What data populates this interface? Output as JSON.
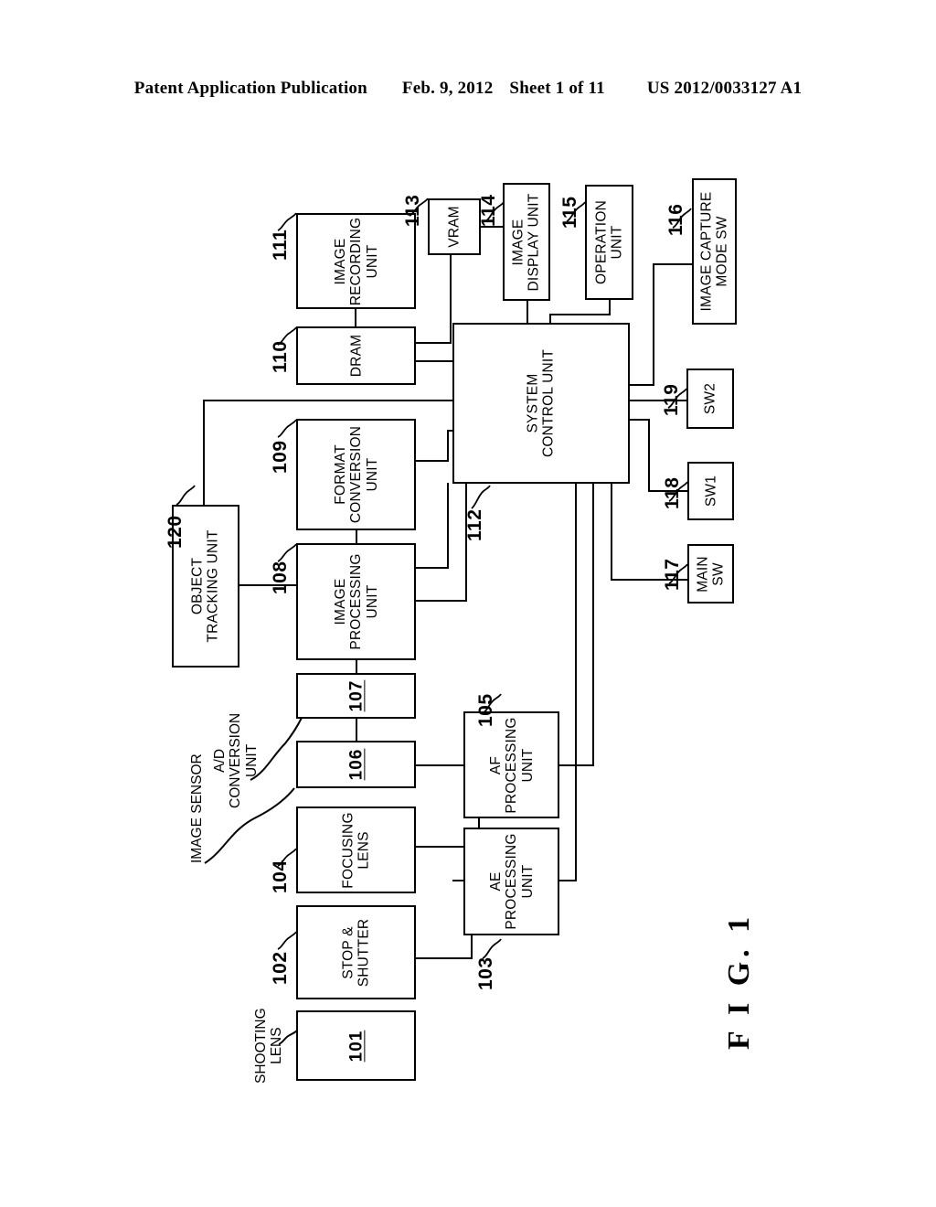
{
  "header": {
    "publication": "Patent Application Publication",
    "date": "Feb. 9, 2012",
    "sheet": "Sheet 1 of 11",
    "patent_number": "US 2012/0033127 A1"
  },
  "figure": {
    "caption": "F I G.  1"
  },
  "diagram": {
    "type": "block-diagram",
    "orientation": "rotated-90-ccw",
    "blocks": [
      {
        "ref": "101",
        "label": "",
        "inner_number": "101",
        "external_label": "SHOOTING LENS"
      },
      {
        "ref": "102",
        "label": "STOP &\nSHUTTER",
        "inner_number": "",
        "external_label": ""
      },
      {
        "ref": "103",
        "label": "AE\nPROCESSING\nUNIT",
        "inner_number": "",
        "external_label": ""
      },
      {
        "ref": "104",
        "label": "FOCUSING\nLENS",
        "inner_number": "",
        "external_label": ""
      },
      {
        "ref": "105",
        "label": "AF\nPROCESSING\nUNIT",
        "inner_number": "",
        "external_label": ""
      },
      {
        "ref": "106",
        "label": "",
        "inner_number": "106",
        "external_label": "IMAGE SENSOR"
      },
      {
        "ref": "107",
        "label": "",
        "inner_number": "107",
        "external_label": "A/D\nCONVERSION\nUNIT"
      },
      {
        "ref": "108",
        "label": "IMAGE\nPROCESSING\nUNIT",
        "inner_number": "",
        "external_label": ""
      },
      {
        "ref": "109",
        "label": "FORMAT\nCONVERSION\nUNIT",
        "inner_number": "",
        "external_label": ""
      },
      {
        "ref": "110",
        "label": "DRAM",
        "inner_number": "",
        "external_label": ""
      },
      {
        "ref": "111",
        "label": "IMAGE\nRECORDING\nUNIT",
        "inner_number": "",
        "external_label": ""
      },
      {
        "ref": "112",
        "label": "SYSTEM\nCONTROL UNIT",
        "inner_number": "",
        "external_label": ""
      },
      {
        "ref": "113",
        "label": "VRAM",
        "inner_number": "",
        "external_label": ""
      },
      {
        "ref": "114",
        "label": "IMAGE\nDISPLAY UNIT",
        "inner_number": "",
        "external_label": ""
      },
      {
        "ref": "115",
        "label": "OPERATION\nUNIT",
        "inner_number": "",
        "external_label": ""
      },
      {
        "ref": "116",
        "label": "IMAGE CAPTURE\nMODE SW",
        "inner_number": "",
        "external_label": ""
      },
      {
        "ref": "117",
        "label": "MAIN\nSW",
        "inner_number": "",
        "external_label": ""
      },
      {
        "ref": "118",
        "label": "SW1",
        "inner_number": "",
        "external_label": ""
      },
      {
        "ref": "119",
        "label": "SW2",
        "inner_number": "",
        "external_label": ""
      },
      {
        "ref": "120",
        "label": "OBJECT\nTRACKING UNIT",
        "inner_number": "",
        "external_label": ""
      }
    ]
  },
  "labels": {
    "image_recording_unit_l1": "IMAGE",
    "image_recording_unit_l2": "RECORDING",
    "image_recording_unit_l3": "UNIT",
    "dram": "DRAM",
    "vram": "VRAM",
    "image_display_unit_l1": "IMAGE",
    "image_display_unit_l2": "DISPLAY UNIT",
    "operation_unit_l1": "OPERATION",
    "operation_unit_l2": "UNIT",
    "image_capture_mode_sw_l1": "IMAGE CAPTURE",
    "image_capture_mode_sw_l2": "MODE SW",
    "system_control_unit_l1": "SYSTEM",
    "system_control_unit_l2": "CONTROL UNIT",
    "sw2": "SW2",
    "sw1": "SW1",
    "main_sw_l1": "MAIN",
    "main_sw_l2": "SW",
    "format_conversion_unit_l1": "FORMAT",
    "format_conversion_unit_l2": "CONVERSION",
    "format_conversion_unit_l3": "UNIT",
    "object_tracking_unit_l1": "OBJECT",
    "object_tracking_unit_l2": "TRACKING UNIT",
    "image_processing_unit_l1": "IMAGE",
    "image_processing_unit_l2": "PROCESSING",
    "image_processing_unit_l3": "UNIT",
    "ad_conversion_unit_l1": "A/D",
    "ad_conversion_unit_l2": "CONVERSION",
    "ad_conversion_unit_l3": "UNIT",
    "image_sensor": "IMAGE SENSOR",
    "focusing_lens_l1": "FOCUSING",
    "focusing_lens_l2": "LENS",
    "stop_shutter_l1": "STOP &",
    "stop_shutter_l2": "SHUTTER",
    "af_processing_unit_l1": "AF",
    "af_processing_unit_l2": "PROCESSING",
    "af_processing_unit_l3": "UNIT",
    "ae_processing_unit_l1": "AE",
    "ae_processing_unit_l2": "PROCESSING",
    "ae_processing_unit_l3": "UNIT",
    "shooting_lens_l1": "SHOOTING",
    "shooting_lens_l2": "LENS",
    "num_101": "101",
    "num_106": "106",
    "num_107": "107"
  },
  "refs": {
    "r101": "101",
    "r102": "102",
    "r103": "103",
    "r104": "104",
    "r105": "105",
    "r108": "108",
    "r109": "109",
    "r110": "110",
    "r111": "111",
    "r112": "112",
    "r113": "113",
    "r114": "114",
    "r115": "115",
    "r116": "116",
    "r117": "117",
    "r118": "118",
    "r119": "119",
    "r120": "120"
  }
}
